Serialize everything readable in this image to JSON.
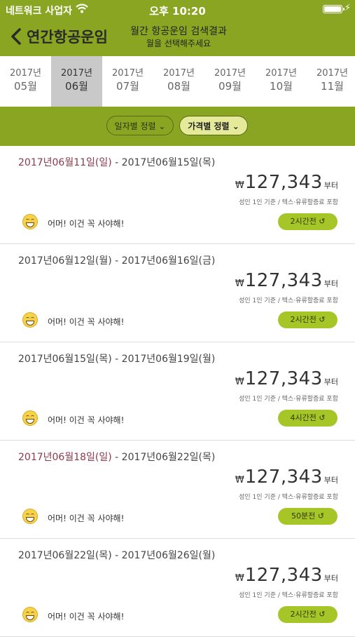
{
  "status_bar": {
    "carrier": "네트워크 사업자",
    "time": "오후 10:20"
  },
  "nav": {
    "back_label": "연간항공운임",
    "title": "월간 항공운임 검색결과",
    "subtitle": "월을 선택해주세요"
  },
  "months": [
    {
      "year": "2017년",
      "month": "05월",
      "selected": false
    },
    {
      "year": "2017년",
      "month": "06월",
      "selected": true
    },
    {
      "year": "2017년",
      "month": "07월",
      "selected": false
    },
    {
      "year": "2017년",
      "month": "08월",
      "selected": false
    },
    {
      "year": "2017년",
      "month": "09월",
      "selected": false
    },
    {
      "year": "2017년",
      "month": "10월",
      "selected": false
    },
    {
      "year": "2017년",
      "month": "11월",
      "selected": false
    }
  ],
  "sort": {
    "by_date": "일자별 정렬 ⌄",
    "by_price": "가격별 정렬 ⌄"
  },
  "colors": {
    "brand": "#8aa522",
    "badge": "#a6c628",
    "holiday": "#8a3a4a"
  },
  "results": [
    {
      "start_a": "2017년06월11일(일)",
      "start_holiday": true,
      "sep": " - ",
      "end": "2017년06월15일(목)",
      "currency": "₩",
      "price": "127,343",
      "suffix": "부터",
      "note": "성인 1인 기준 / 텍스·유류할증료 포함",
      "message": "어머! 이건 꼭 사야해!",
      "updated": "2시간전 ↺"
    },
    {
      "start_a": "2017년06월12일(월)",
      "start_holiday": false,
      "sep": " - ",
      "end": "2017년06월16일(금)",
      "currency": "₩",
      "price": "127,343",
      "suffix": "부터",
      "note": "성인 1인 기준 / 텍스·유류할증료 포함",
      "message": "어머! 이건 꼭 사야해!",
      "updated": "2시간전 ↺"
    },
    {
      "start_a": "2017년06월15일(목)",
      "start_holiday": false,
      "sep": " - ",
      "end": "2017년06월19일(월)",
      "currency": "₩",
      "price": "127,343",
      "suffix": "부터",
      "note": "성인 1인 기준 / 텍스·유류할증료 포함",
      "message": "어머! 이건 꼭 사야해!",
      "updated": "4시간전 ↺"
    },
    {
      "start_a": "2017년06월18일(일)",
      "start_holiday": true,
      "sep": " - ",
      "end": "2017년06월22일(목)",
      "currency": "₩",
      "price": "127,343",
      "suffix": "부터",
      "note": "성인 1인 기준 / 텍스·유류할증료 포함",
      "message": "어머! 이건 꼭 사야해!",
      "updated": "50분전 ↺"
    },
    {
      "start_a": "2017년06월22일(목)",
      "start_holiday": false,
      "sep": " - ",
      "end": "2017년06월26일(월)",
      "currency": "₩",
      "price": "127,343",
      "suffix": "부터",
      "note": "성인 1인 기준 / 텍스·유류할증료 포함",
      "message": "어머! 이건 꼭 사야해!",
      "updated": "2시간전 ↺"
    }
  ]
}
